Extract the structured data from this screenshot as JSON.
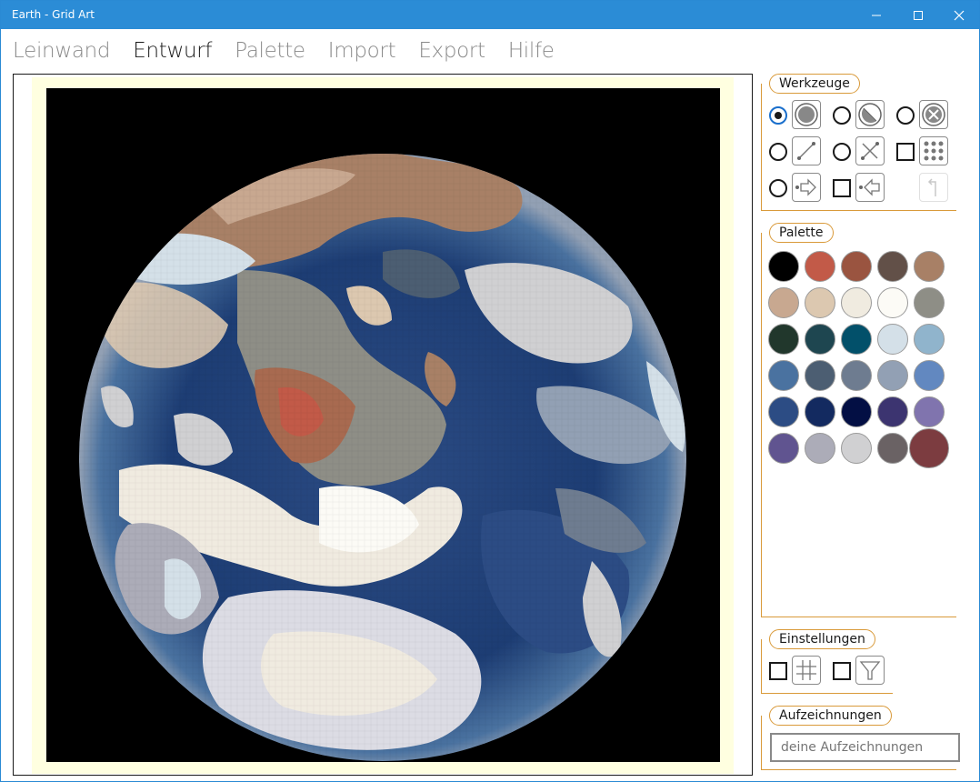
{
  "window": {
    "title": "Earth - Grid Art"
  },
  "menu": {
    "items": [
      {
        "label": "Leinwand",
        "active": false
      },
      {
        "label": "Entwurf",
        "active": true
      },
      {
        "label": "Palette",
        "active": false
      },
      {
        "label": "Import",
        "active": false
      },
      {
        "label": "Export",
        "active": false
      },
      {
        "label": "Hilfe",
        "active": false
      }
    ]
  },
  "tools": {
    "label": "Werkzeuge",
    "items": [
      {
        "icon": "fill-circle-icon",
        "selected": true
      },
      {
        "icon": "half-circle-icon",
        "selected": false
      },
      {
        "icon": "erase-circle-icon",
        "selected": false
      },
      {
        "icon": "line-icon",
        "selected": false
      },
      {
        "icon": "cross-line-icon",
        "selected": false
      },
      {
        "icon": "dot-grid-icon",
        "selected": false
      },
      {
        "icon": "arrow-right-icon",
        "selected": false
      },
      {
        "icon": "arrow-left-icon",
        "selected": false
      },
      {
        "icon": "undo-icon",
        "selected": false
      }
    ]
  },
  "palette": {
    "label": "Palette",
    "colors": [
      "#000000",
      "#c25a48",
      "#9a5440",
      "#625048",
      "#a88066",
      "#c8a890",
      "#dcc8b0",
      "#f0ebe0",
      "#fcfbf6",
      "#8e8e86",
      "#21372c",
      "#1e4650",
      "#02506a",
      "#d4e0e8",
      "#90b4cc",
      "#4a72a0",
      "#4c5e72",
      "#6e7c90",
      "#92a0b4",
      "#6288c0",
      "#2c4c84",
      "#132a60",
      "#030f44",
      "#3c3470",
      "#8074ae",
      "#605490",
      "#acacb8",
      "#d0d0d2",
      "#6a6264",
      "#7c3c40"
    ],
    "selected_index": 29
  },
  "settings": {
    "label": "Einstellungen"
  },
  "notes": {
    "label": "Aufzeichnungen",
    "placeholder": "deine Aufzeichnungen"
  }
}
